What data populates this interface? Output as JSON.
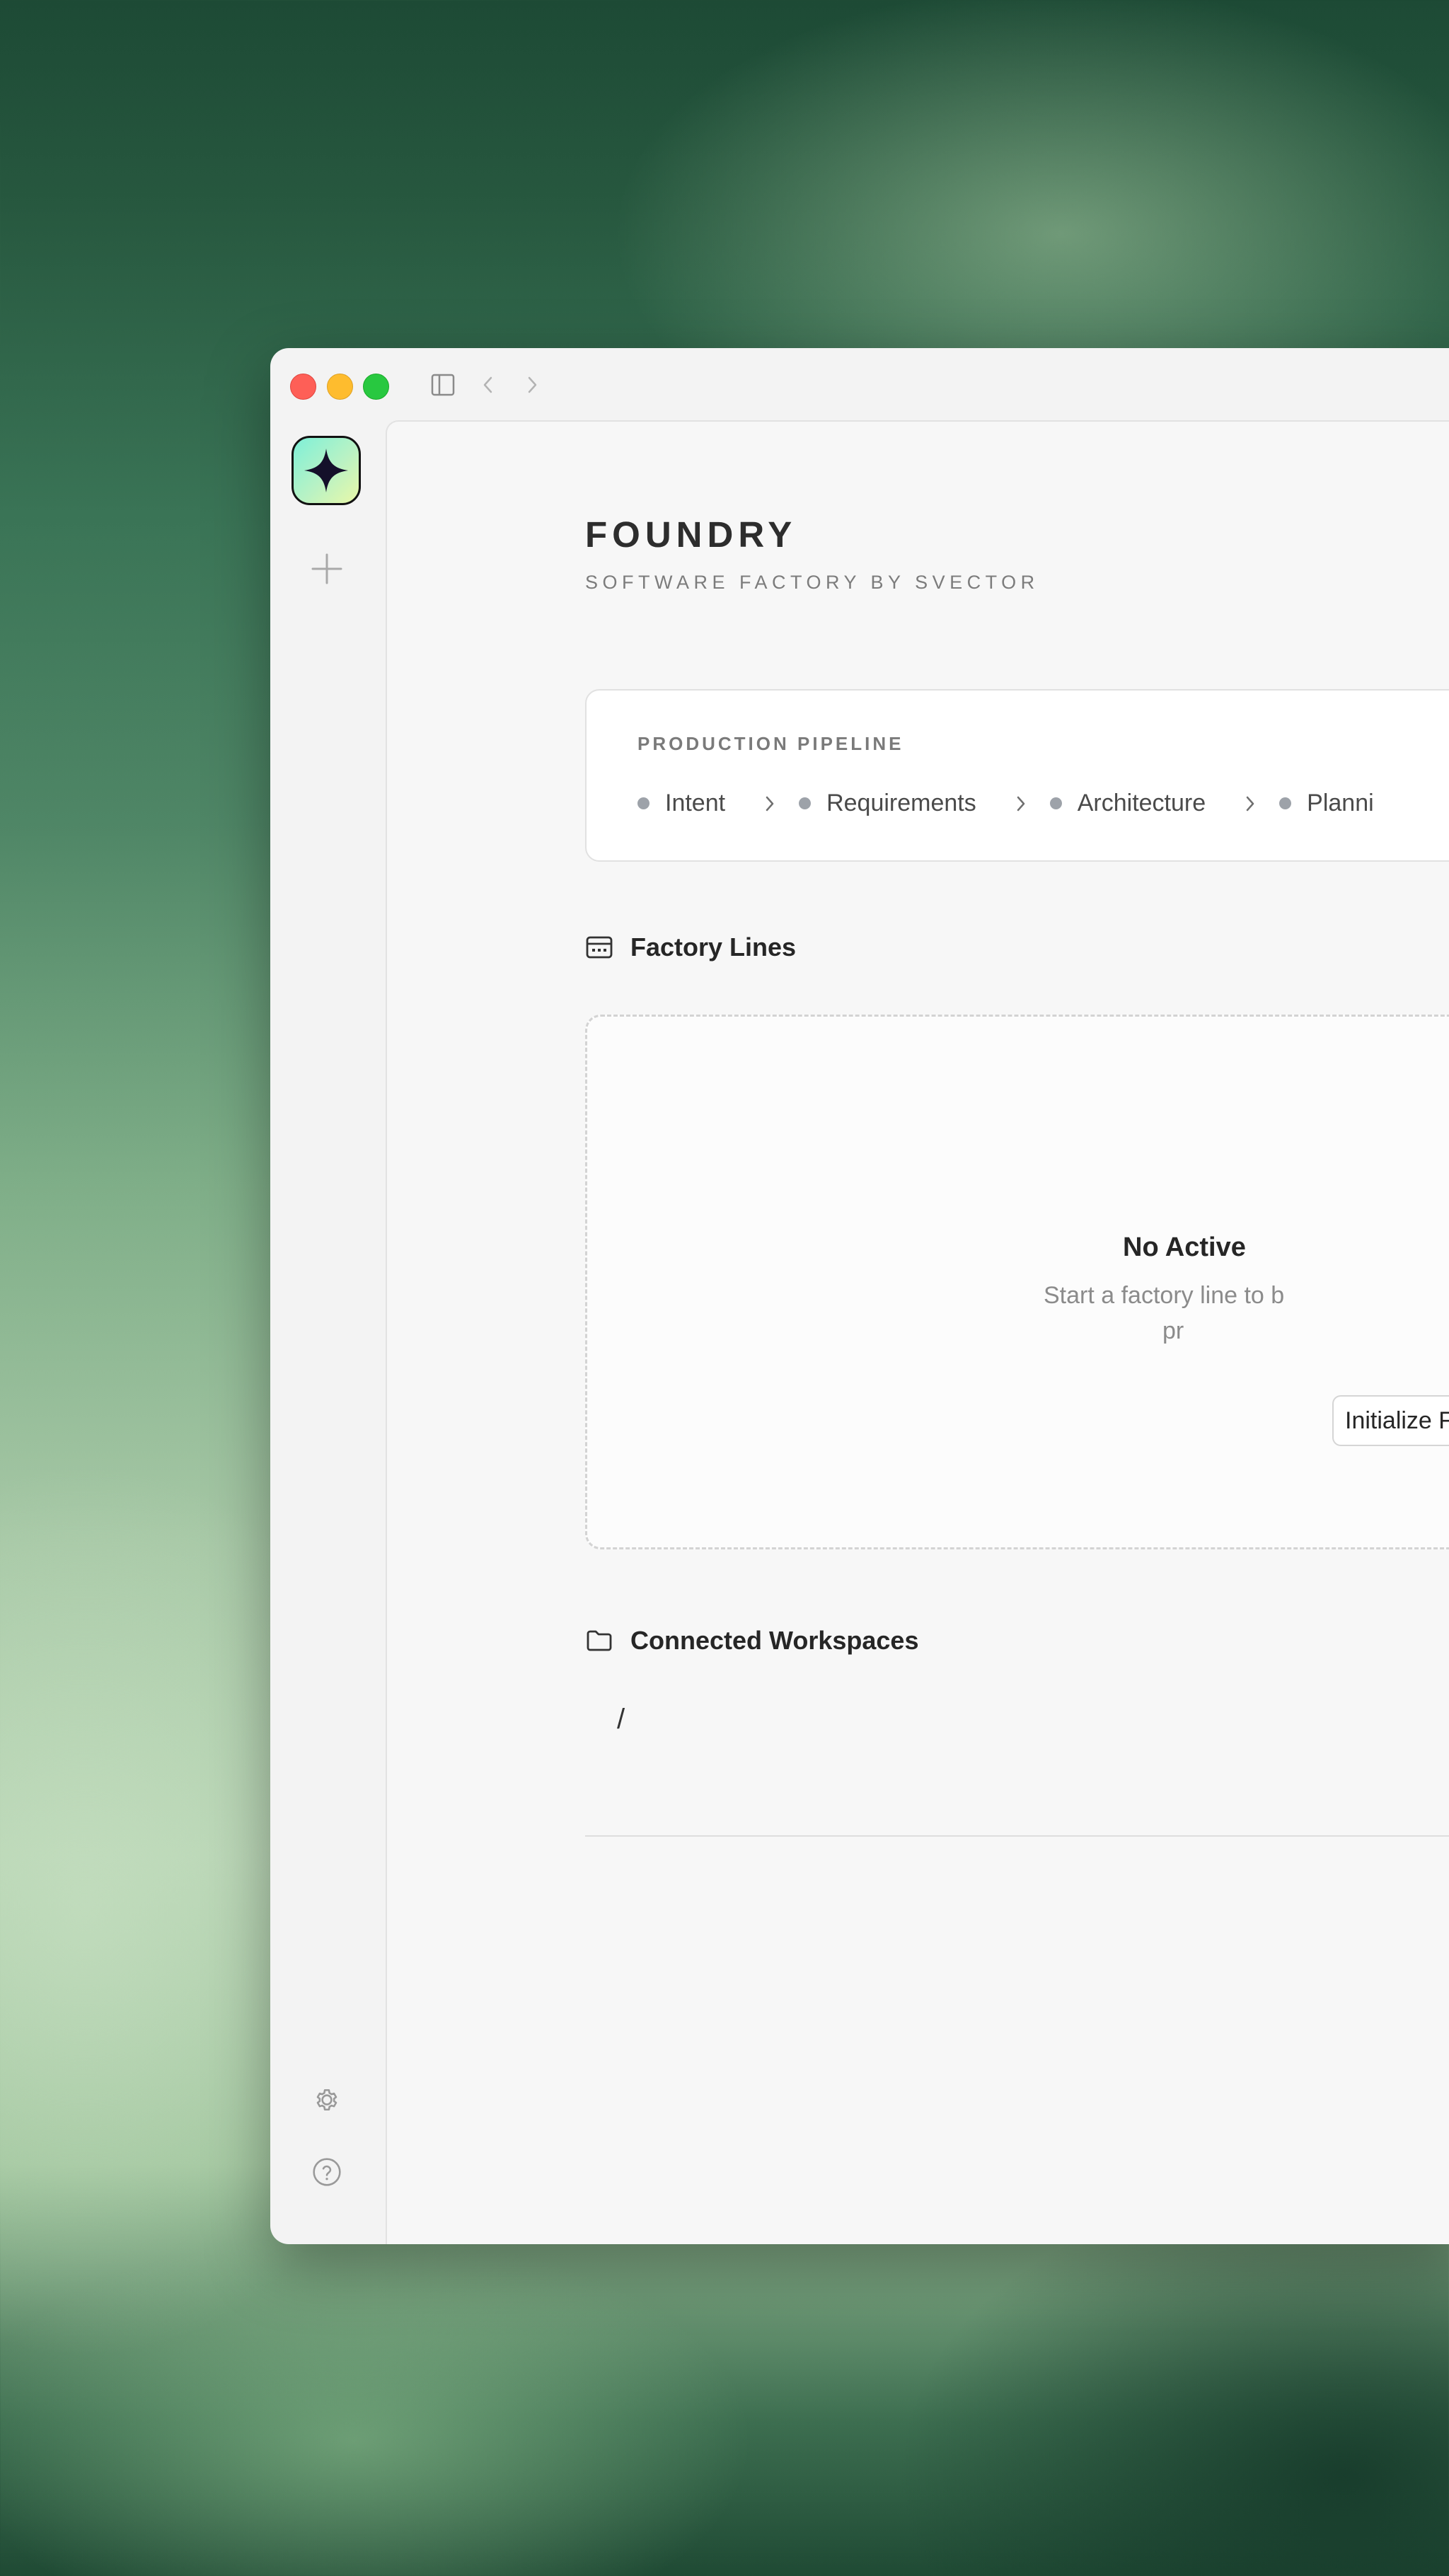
{
  "window": {
    "traffic_lights": [
      "close",
      "minimize",
      "zoom"
    ],
    "toolbar_icons": [
      "sidebar-toggle-icon",
      "back-chevron-icon",
      "forward-chevron-icon"
    ]
  },
  "sidebar": {
    "logo_icon": "sparkle-icon",
    "new_icon": "plus-icon",
    "bottom_icons": [
      "gear-icon",
      "help-icon"
    ]
  },
  "header": {
    "title": "FOUNDRY",
    "subtitle": "SOFTWARE FACTORY BY SVECTOR"
  },
  "pipeline": {
    "label": "PRODUCTION PIPELINE",
    "stages": [
      "Intent",
      "Requirements",
      "Architecture",
      "Planni"
    ]
  },
  "factory_lines": {
    "heading": "Factory Lines",
    "icon": "factory-lines-icon",
    "empty_title": "No Active",
    "empty_desc_line1": "Start a factory line to b",
    "empty_desc_line2": "pr",
    "init_button": "Initialize F"
  },
  "workspaces": {
    "heading": "Connected Workspaces",
    "icon": "folder-icon",
    "items": [
      "/"
    ]
  },
  "colors": {
    "dot": "#9da2a9",
    "accent_logo_start": "#7ef0d8",
    "accent_logo_end": "#e9f8a8"
  }
}
